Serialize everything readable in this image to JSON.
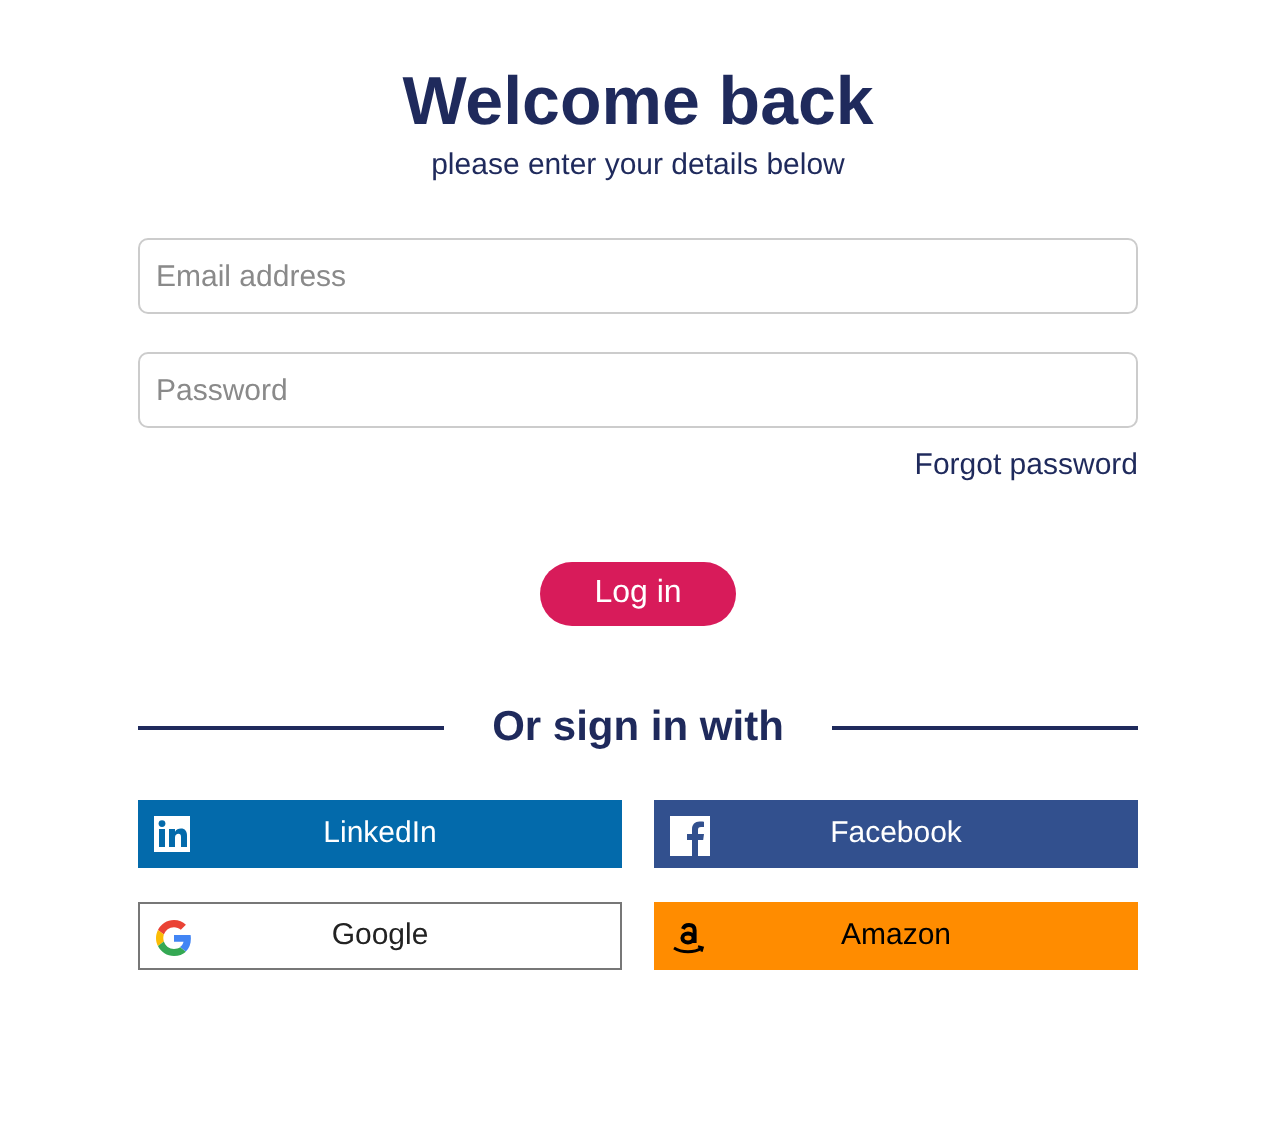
{
  "heading": {
    "title": "Welcome back",
    "subtitle": "please enter your details below"
  },
  "fields": [
    {
      "placeholder": "Email address"
    },
    {
      "placeholder": "Password"
    }
  ],
  "forgot_link": "Forgot password",
  "login_button": "Log in",
  "divider_label": "Or sign in with",
  "social_buttons": [
    {
      "label": "LinkedIn",
      "kind": "linkedin"
    },
    {
      "label": "Facebook",
      "kind": "facebook"
    },
    {
      "label": "Google",
      "kind": "google"
    },
    {
      "label": "Amazon",
      "kind": "amazon"
    }
  ]
}
